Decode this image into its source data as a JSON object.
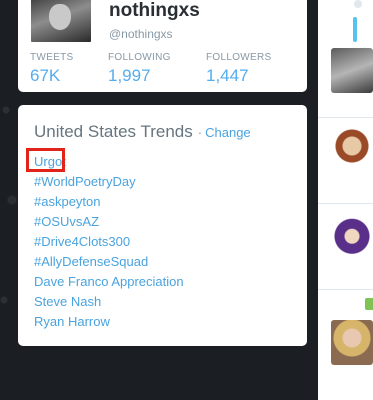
{
  "profile": {
    "name": "nothingxs",
    "handle": "@nothingxs",
    "stats": [
      {
        "label": "TWEETS",
        "value": "67K"
      },
      {
        "label": "FOLLOWING",
        "value": "1,997"
      },
      {
        "label": "FOLLOWERS",
        "value": "1,447"
      }
    ]
  },
  "trends": {
    "title": "United States Trends",
    "separator": "·",
    "change_label": "Change",
    "items": [
      "Urgot",
      "#WorldPoetryDay",
      "#askpeyton",
      "#OSUvsAZ",
      "#Drive4Clots300",
      "#AllyDefenseSquad",
      "Dave Franco Appreciation",
      "Steve Nash",
      "Ryan Harrow"
    ]
  },
  "timeline": {
    "avatars": [
      "man-portrait",
      "cartoon-character",
      "purple-hooded-character",
      "blonde-character"
    ]
  }
}
